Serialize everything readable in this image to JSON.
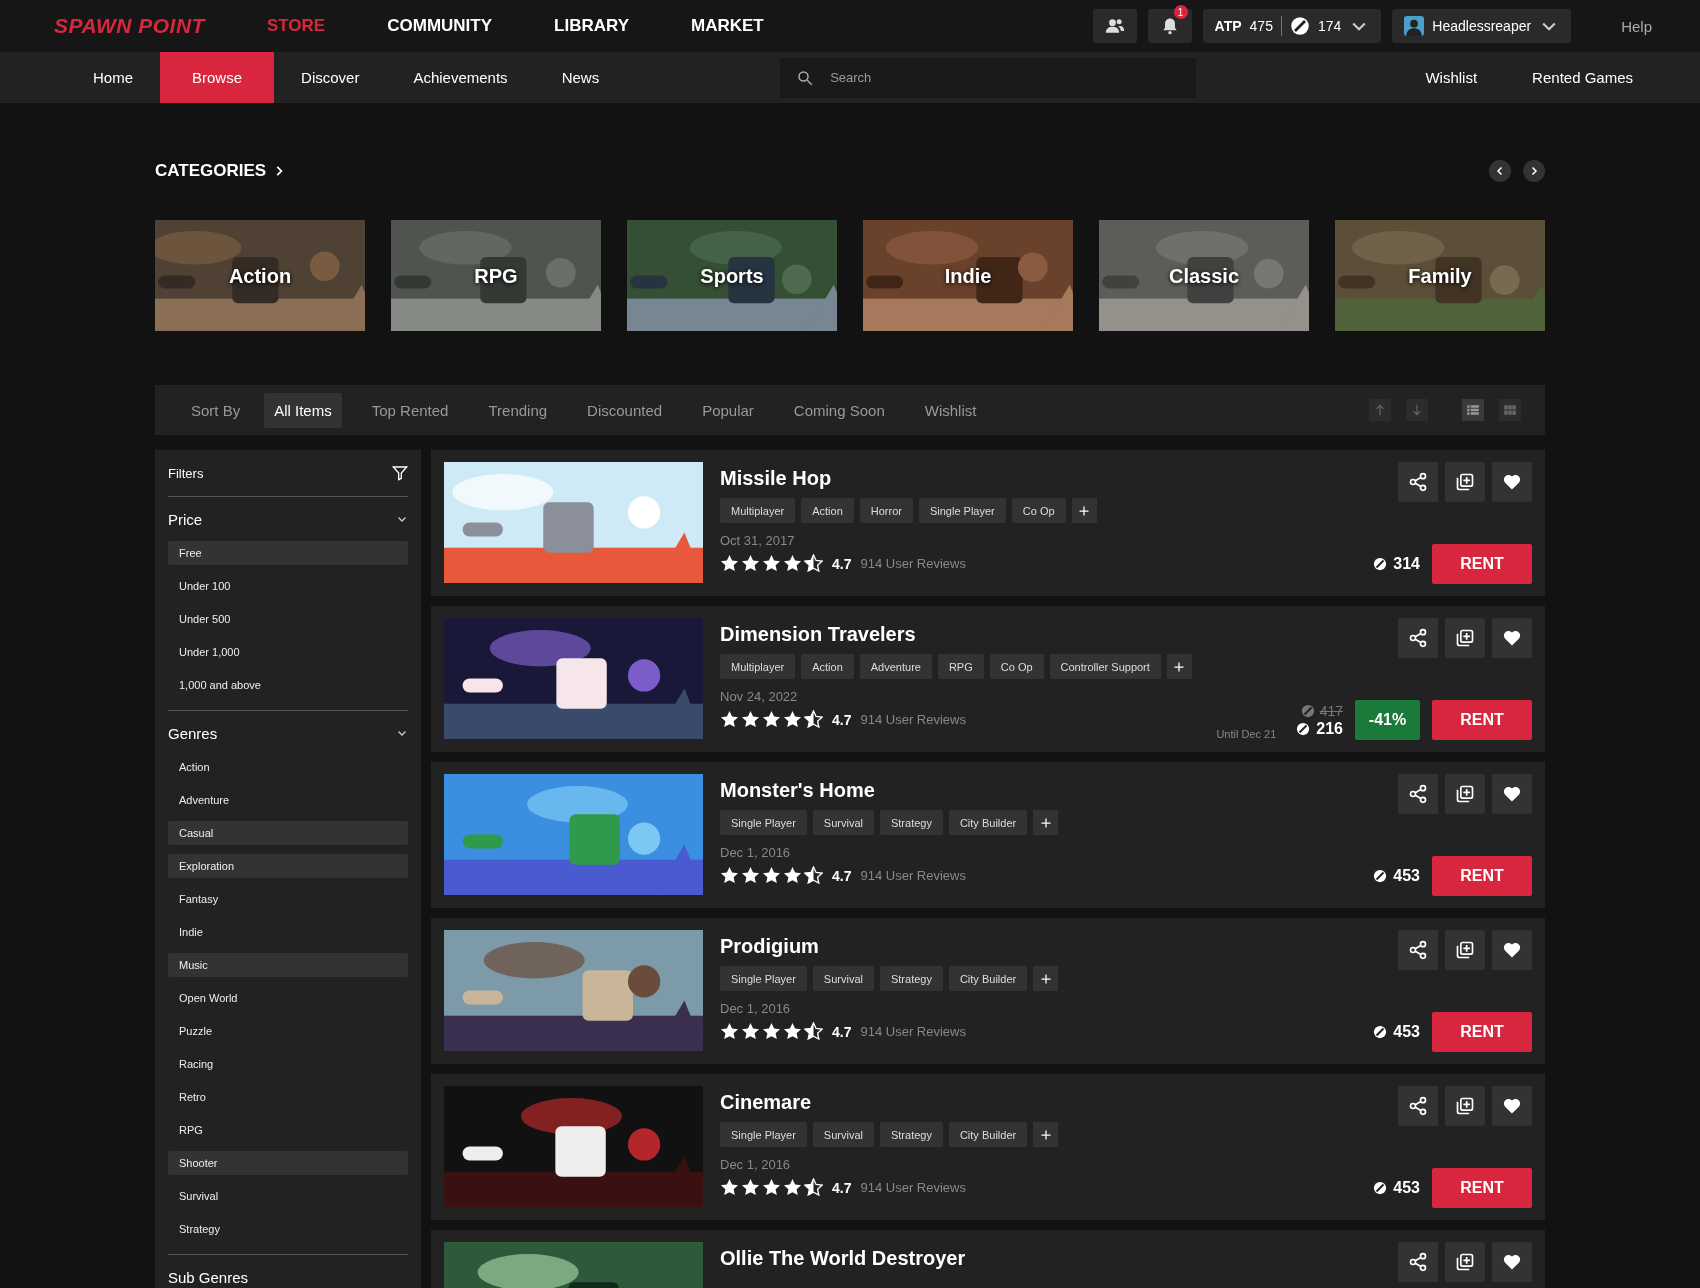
{
  "topbar": {
    "logo": "SPAWN POINT",
    "nav": [
      {
        "label": "STORE",
        "selected": true
      },
      {
        "label": "COMMUNITY",
        "selected": false
      },
      {
        "label": "LIBRARY",
        "selected": false
      },
      {
        "label": "MARKET",
        "selected": false
      }
    ],
    "notifications": "1",
    "atp_label": "ATP",
    "atp_value": "475",
    "coins": "174",
    "username": "Headlessreaper",
    "help": "Help"
  },
  "subnav": {
    "items": [
      {
        "label": "Home",
        "selected": false
      },
      {
        "label": "Browse",
        "selected": true
      },
      {
        "label": "Discover",
        "selected": false
      },
      {
        "label": "Achievements",
        "selected": false
      },
      {
        "label": "News",
        "selected": false
      }
    ],
    "search": {
      "placeholder": "Search"
    },
    "right": [
      "Wishlist",
      "Rented Games"
    ]
  },
  "categories": {
    "title": "CATEGORIES",
    "items": [
      "Action",
      "RPG",
      "Sports",
      "Indie",
      "Classic",
      "Family"
    ]
  },
  "sortbar": {
    "label": "Sort By",
    "tabs": [
      {
        "label": "All Items",
        "selected": true
      },
      {
        "label": "Top Rented",
        "selected": false
      },
      {
        "label": "Trending",
        "selected": false
      },
      {
        "label": "Discounted",
        "selected": false
      },
      {
        "label": "Popular",
        "selected": false
      },
      {
        "label": "Coming Soon",
        "selected": false
      },
      {
        "label": "Wishlist",
        "selected": false
      }
    ],
    "view_buttons": [
      {
        "kind": "list",
        "selected": true
      },
      {
        "kind": "grid",
        "selected": false
      }
    ]
  },
  "filters": {
    "title": "Filters",
    "groups": [
      {
        "title": "Price",
        "expanded": true,
        "items": [
          {
            "label": "Free",
            "selected": true
          },
          {
            "label": "Under 100",
            "selected": false
          },
          {
            "label": "Under 500",
            "selected": false
          },
          {
            "label": "Under 1,000",
            "selected": false
          },
          {
            "label": "1,000 and above",
            "selected": false
          }
        ]
      },
      {
        "title": "Genres",
        "expanded": true,
        "items": [
          {
            "label": "Action",
            "selected": false
          },
          {
            "label": "Adventure",
            "selected": false
          },
          {
            "label": "Casual",
            "selected": true
          },
          {
            "label": "Exploration",
            "selected": true
          },
          {
            "label": "Fantasy",
            "selected": false
          },
          {
            "label": "Indie",
            "selected": false
          },
          {
            "label": "Music",
            "selected": true
          },
          {
            "label": "Open World",
            "selected": false
          },
          {
            "label": "Puzzle",
            "selected": false
          },
          {
            "label": "Racing",
            "selected": false
          },
          {
            "label": "Retro",
            "selected": false
          },
          {
            "label": "RPG",
            "selected": false
          },
          {
            "label": "Shooter",
            "selected": true
          },
          {
            "label": "Survival",
            "selected": false
          },
          {
            "label": "Strategy",
            "selected": false
          }
        ]
      },
      {
        "title": "Sub Genres"
      }
    ]
  },
  "games": [
    {
      "title": "Missile Hop",
      "tags": [
        "Multiplayer",
        "Action",
        "Horror",
        "Single Player",
        "Co Op"
      ],
      "date": "Oct 31, 2017",
      "stars": 4.5,
      "rating": "4.7",
      "reviews": "914 User Reviews",
      "price": "314",
      "rent": "RENT"
    },
    {
      "title": "Dimension Travelers",
      "tags": [
        "Multiplayer",
        "Action",
        "Adventure",
        "RPG",
        "Co Op",
        "Controller Support"
      ],
      "date": "Nov 24, 2022",
      "stars": 4.5,
      "rating": "4.7",
      "reviews": "914 User Reviews",
      "old_price": "417",
      "price": "216",
      "until": "Until Dec 21",
      "discount": "-41%",
      "rent": "RENT"
    },
    {
      "title": "Monster's Home",
      "tags": [
        "Single Player",
        "Survival",
        "Strategy",
        "City Builder"
      ],
      "date": "Dec 1, 2016",
      "stars": 4.5,
      "rating": "4.7",
      "reviews": "914 User Reviews",
      "price": "453",
      "rent": "RENT"
    },
    {
      "title": "Prodigium",
      "tags": [
        "Single Player",
        "Survival",
        "Strategy",
        "City Builder"
      ],
      "date": "Dec 1, 2016",
      "stars": 4.5,
      "rating": "4.7",
      "reviews": "914 User Reviews",
      "price": "453",
      "rent": "RENT"
    },
    {
      "title": "Cinemare",
      "tags": [
        "Single Player",
        "Survival",
        "Strategy",
        "City Builder"
      ],
      "date": "Dec 1, 2016",
      "stars": 4.5,
      "rating": "4.7",
      "reviews": "914 User Reviews",
      "price": "453",
      "rent": "RENT"
    },
    {
      "title": "Ollie The World Destroyer"
    }
  ]
}
